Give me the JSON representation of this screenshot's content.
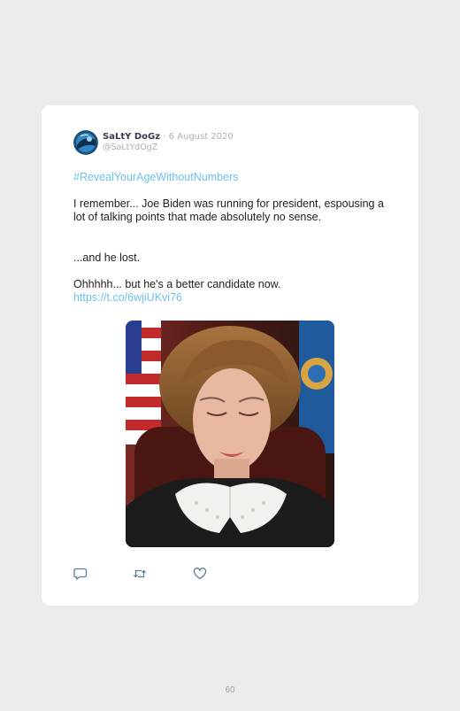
{
  "tweet": {
    "author_name": "SaLtY DoGz",
    "separator": "·",
    "date": "6 August 2020",
    "handle": "@SaLtYdOgZ",
    "hashtag": "#RevealYourAgeWithoutNumbers",
    "paragraphs": [
      "I remember... Joe Biden was running for president, espousing a lot of talking points that made absolutely no sense.",
      "...and he lost.",
      "Ohhhhh... but he's a better candidate now."
    ],
    "link": "https://t.co/6wjiUKvi76",
    "avatar_icon": "avatar-globe",
    "media_description_icon": "judge-photo",
    "actions": [
      {
        "name": "reply",
        "icon": "reply-icon"
      },
      {
        "name": "retweet",
        "icon": "retweet-icon"
      },
      {
        "name": "like",
        "icon": "heart-icon"
      }
    ]
  },
  "page": {
    "number": "60"
  },
  "colors": {
    "background": "#ececea",
    "card": "#ffffff",
    "link": "#6cc1ee",
    "text": "#1f1f1f",
    "muted": "#a9b0b8",
    "name": "#333c4b"
  }
}
